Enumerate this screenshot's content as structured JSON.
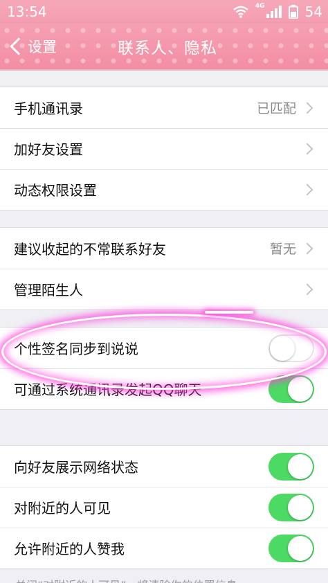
{
  "status_bar": {
    "time": "13:54",
    "network": "4G",
    "battery": "54"
  },
  "nav": {
    "back_label": "设置",
    "title": "联系人、隐私"
  },
  "groups": [
    {
      "rows": [
        {
          "label": "手机通讯录",
          "value": "已匹配",
          "control": "chevron"
        },
        {
          "label": "加好友设置",
          "control": "chevron"
        },
        {
          "label": "动态权限设置",
          "control": "chevron"
        }
      ]
    },
    {
      "rows": [
        {
          "label": "建议收起的不常联系好友",
          "value": "暂无",
          "control": "chevron"
        },
        {
          "label": "管理陌生人",
          "control": "chevron"
        }
      ]
    },
    {
      "rows": [
        {
          "label": "个性签名同步到说说",
          "control": "toggle",
          "on": false
        },
        {
          "label": "可通过系统通讯录发起QQ聊天",
          "control": "toggle",
          "on": true
        }
      ]
    },
    {
      "rows": [
        {
          "label": "向好友展示网络状态",
          "control": "toggle",
          "on": true
        },
        {
          "label": "对附近的人可见",
          "control": "toggle",
          "on": true
        },
        {
          "label": "允许附近的人赞我",
          "control": "toggle",
          "on": true
        }
      ]
    }
  ],
  "footer_note": "关闭“对附近的人可见”，将清除你的位置信息",
  "colors": {
    "nav_pink": "#f28ea4",
    "toggle_on": "#4cd964",
    "highlight": "#ff3cdc"
  }
}
